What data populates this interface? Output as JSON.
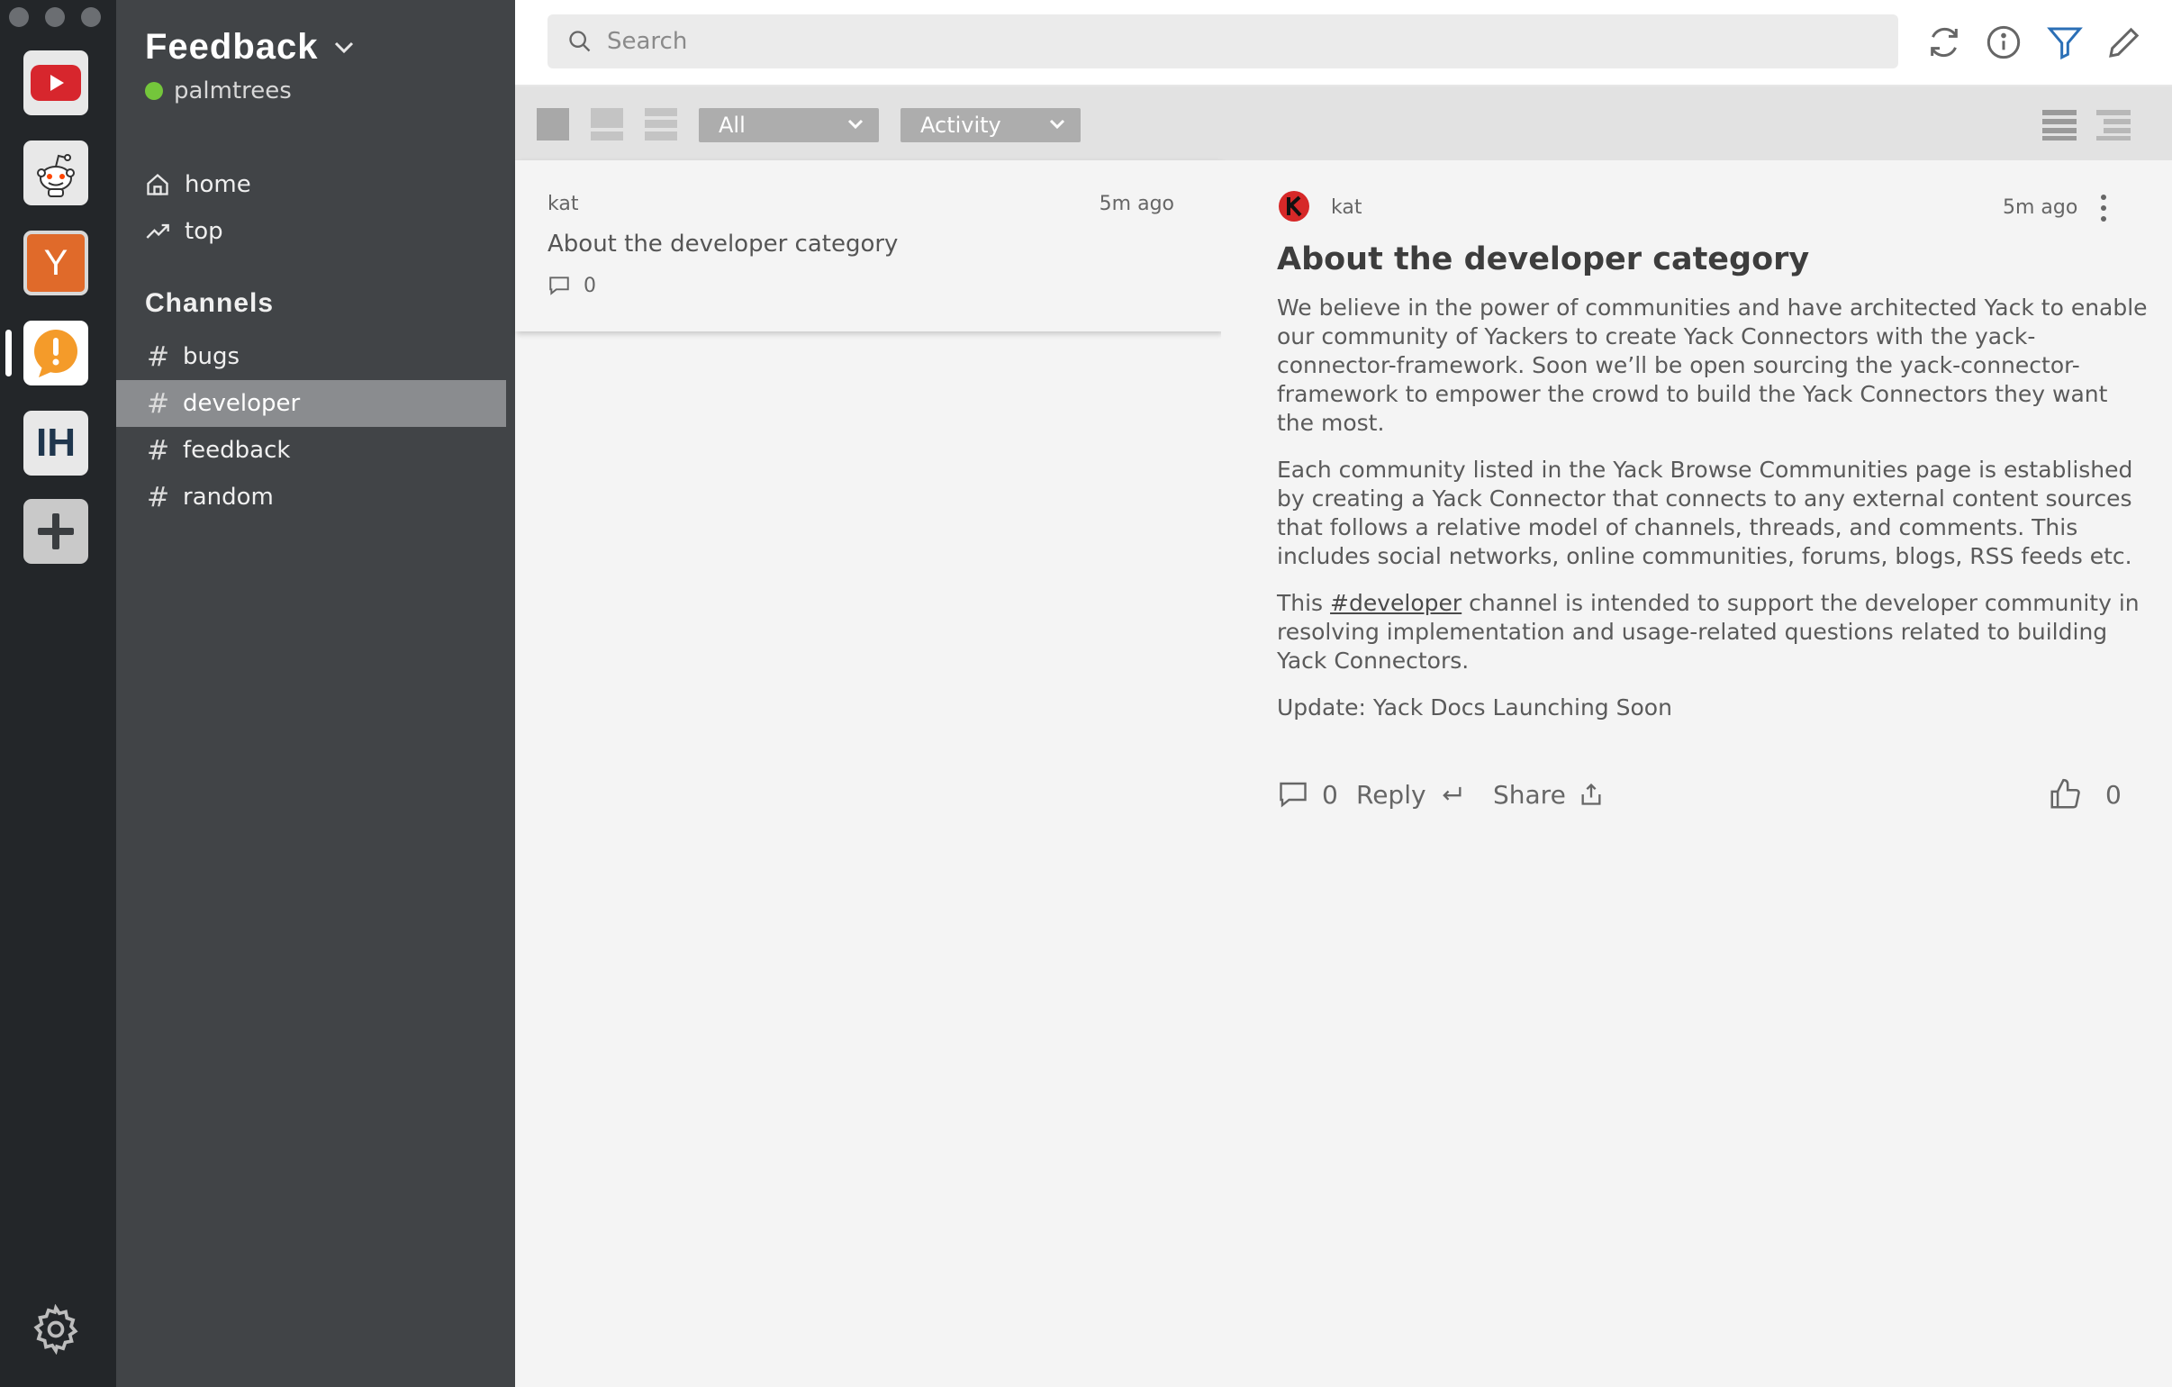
{
  "workspace": {
    "title": "Feedback",
    "username": "palmtrees",
    "status_color": "#74c63b"
  },
  "apps": [
    {
      "name": "youtube-icon",
      "color": "#d7262d"
    },
    {
      "name": "reddit-icon",
      "color": "#ff4500"
    },
    {
      "name": "hacker-news-icon",
      "color": "#e06a2a",
      "letter": "Y"
    },
    {
      "name": "feedback-icon",
      "color": "#f49b2a",
      "letter": "!"
    },
    {
      "name": "indie-hackers-icon",
      "color": "#1f364d",
      "letter": "IH"
    },
    {
      "name": "add-app-icon",
      "letter": "+"
    }
  ],
  "nav": {
    "home": "home",
    "top": "top"
  },
  "channels": {
    "heading": "Channels",
    "items": [
      {
        "label": "bugs",
        "selected": false
      },
      {
        "label": "developer",
        "selected": true
      },
      {
        "label": "feedback",
        "selected": false
      },
      {
        "label": "random",
        "selected": false
      }
    ]
  },
  "search": {
    "placeholder": "Search",
    "value": ""
  },
  "toolbar": {
    "filter_value": "All",
    "sort_value": "Activity",
    "filter_active_color": "#2b6fb6"
  },
  "thread": {
    "author": "kat",
    "time": "5m ago",
    "title": "About the developer category",
    "comment_count": "0"
  },
  "post": {
    "author": "kat",
    "time": "5m ago",
    "title": "About the developer category",
    "p1": "We believe in the power of communities and have architected Yack to enable our community of Yackers to create Yack Connectors with the yack-connector-framework. Soon we’ll be open sourcing the yack-connector-framework to empower the crowd to build the Yack Connectors they want the most.",
    "p2": "Each community listed in the Yack Browse Communities page is established by creating a Yack Connector that connects to any external content sources that follows a relative model of channels, threads, and comments. This includes social networks, online communities, forums, blogs, RSS feeds etc.",
    "p3_prefix": "This ",
    "p3_link": "#developer",
    "p3_suffix": " channel is intended to support the developer community in resolving implementation and usage-related questions related to building Yack Connectors.",
    "p4": "Update: Yack Docs Launching Soon",
    "comment_count": "0",
    "reply_label": "Reply",
    "share_label": "Share",
    "like_count": "0"
  }
}
